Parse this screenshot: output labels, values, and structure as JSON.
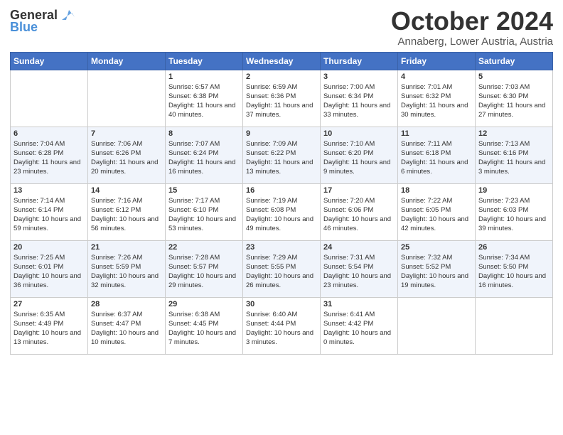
{
  "header": {
    "logo_general": "General",
    "logo_blue": "Blue",
    "month_title": "October 2024",
    "location": "Annaberg, Lower Austria, Austria"
  },
  "days_of_week": [
    "Sunday",
    "Monday",
    "Tuesday",
    "Wednesday",
    "Thursday",
    "Friday",
    "Saturday"
  ],
  "weeks": [
    [
      {
        "day": "",
        "info": ""
      },
      {
        "day": "",
        "info": ""
      },
      {
        "day": "1",
        "info": "Sunrise: 6:57 AM\nSunset: 6:38 PM\nDaylight: 11 hours and 40 minutes."
      },
      {
        "day": "2",
        "info": "Sunrise: 6:59 AM\nSunset: 6:36 PM\nDaylight: 11 hours and 37 minutes."
      },
      {
        "day": "3",
        "info": "Sunrise: 7:00 AM\nSunset: 6:34 PM\nDaylight: 11 hours and 33 minutes."
      },
      {
        "day": "4",
        "info": "Sunrise: 7:01 AM\nSunset: 6:32 PM\nDaylight: 11 hours and 30 minutes."
      },
      {
        "day": "5",
        "info": "Sunrise: 7:03 AM\nSunset: 6:30 PM\nDaylight: 11 hours and 27 minutes."
      }
    ],
    [
      {
        "day": "6",
        "info": "Sunrise: 7:04 AM\nSunset: 6:28 PM\nDaylight: 11 hours and 23 minutes."
      },
      {
        "day": "7",
        "info": "Sunrise: 7:06 AM\nSunset: 6:26 PM\nDaylight: 11 hours and 20 minutes."
      },
      {
        "day": "8",
        "info": "Sunrise: 7:07 AM\nSunset: 6:24 PM\nDaylight: 11 hours and 16 minutes."
      },
      {
        "day": "9",
        "info": "Sunrise: 7:09 AM\nSunset: 6:22 PM\nDaylight: 11 hours and 13 minutes."
      },
      {
        "day": "10",
        "info": "Sunrise: 7:10 AM\nSunset: 6:20 PM\nDaylight: 11 hours and 9 minutes."
      },
      {
        "day": "11",
        "info": "Sunrise: 7:11 AM\nSunset: 6:18 PM\nDaylight: 11 hours and 6 minutes."
      },
      {
        "day": "12",
        "info": "Sunrise: 7:13 AM\nSunset: 6:16 PM\nDaylight: 11 hours and 3 minutes."
      }
    ],
    [
      {
        "day": "13",
        "info": "Sunrise: 7:14 AM\nSunset: 6:14 PM\nDaylight: 10 hours and 59 minutes."
      },
      {
        "day": "14",
        "info": "Sunrise: 7:16 AM\nSunset: 6:12 PM\nDaylight: 10 hours and 56 minutes."
      },
      {
        "day": "15",
        "info": "Sunrise: 7:17 AM\nSunset: 6:10 PM\nDaylight: 10 hours and 53 minutes."
      },
      {
        "day": "16",
        "info": "Sunrise: 7:19 AM\nSunset: 6:08 PM\nDaylight: 10 hours and 49 minutes."
      },
      {
        "day": "17",
        "info": "Sunrise: 7:20 AM\nSunset: 6:06 PM\nDaylight: 10 hours and 46 minutes."
      },
      {
        "day": "18",
        "info": "Sunrise: 7:22 AM\nSunset: 6:05 PM\nDaylight: 10 hours and 42 minutes."
      },
      {
        "day": "19",
        "info": "Sunrise: 7:23 AM\nSunset: 6:03 PM\nDaylight: 10 hours and 39 minutes."
      }
    ],
    [
      {
        "day": "20",
        "info": "Sunrise: 7:25 AM\nSunset: 6:01 PM\nDaylight: 10 hours and 36 minutes."
      },
      {
        "day": "21",
        "info": "Sunrise: 7:26 AM\nSunset: 5:59 PM\nDaylight: 10 hours and 32 minutes."
      },
      {
        "day": "22",
        "info": "Sunrise: 7:28 AM\nSunset: 5:57 PM\nDaylight: 10 hours and 29 minutes."
      },
      {
        "day": "23",
        "info": "Sunrise: 7:29 AM\nSunset: 5:55 PM\nDaylight: 10 hours and 26 minutes."
      },
      {
        "day": "24",
        "info": "Sunrise: 7:31 AM\nSunset: 5:54 PM\nDaylight: 10 hours and 23 minutes."
      },
      {
        "day": "25",
        "info": "Sunrise: 7:32 AM\nSunset: 5:52 PM\nDaylight: 10 hours and 19 minutes."
      },
      {
        "day": "26",
        "info": "Sunrise: 7:34 AM\nSunset: 5:50 PM\nDaylight: 10 hours and 16 minutes."
      }
    ],
    [
      {
        "day": "27",
        "info": "Sunrise: 6:35 AM\nSunset: 4:49 PM\nDaylight: 10 hours and 13 minutes."
      },
      {
        "day": "28",
        "info": "Sunrise: 6:37 AM\nSunset: 4:47 PM\nDaylight: 10 hours and 10 minutes."
      },
      {
        "day": "29",
        "info": "Sunrise: 6:38 AM\nSunset: 4:45 PM\nDaylight: 10 hours and 7 minutes."
      },
      {
        "day": "30",
        "info": "Sunrise: 6:40 AM\nSunset: 4:44 PM\nDaylight: 10 hours and 3 minutes."
      },
      {
        "day": "31",
        "info": "Sunrise: 6:41 AM\nSunset: 4:42 PM\nDaylight: 10 hours and 0 minutes."
      },
      {
        "day": "",
        "info": ""
      },
      {
        "day": "",
        "info": ""
      }
    ]
  ]
}
